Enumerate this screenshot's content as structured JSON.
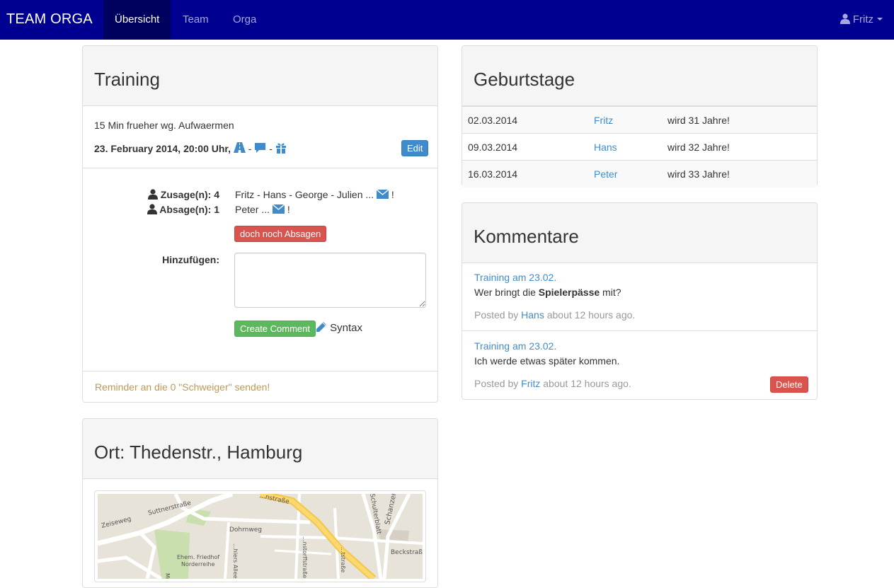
{
  "navbar": {
    "brand": "TEAM ORGA",
    "tabs": [
      {
        "label": "Übersicht",
        "active": true
      },
      {
        "label": "Team",
        "active": false
      },
      {
        "label": "Orga",
        "active": false
      }
    ],
    "user": "Fritz",
    "bg_color": "#000090"
  },
  "training": {
    "title": "Training",
    "note": "15 Min frueher wg. Aufwaermen",
    "datetime": "23. February 2014, 20:00 Uhr,",
    "sep1": "-",
    "sep2": "-",
    "edit_label": "Edit",
    "icons": [
      "road-icon",
      "comment-icon",
      "gift-icon"
    ],
    "zusage_label": "Zusage(n): 4",
    "zusage_names": "Fritz - Hans - George - Julien ...",
    "absage_label": "Absage(n): 1",
    "absage_names": "Peter ...",
    "excl": "!",
    "decline_label": "doch noch Absagen",
    "add_label": "Hinzufügen:",
    "create_label": "Create Comment",
    "syntax_label": "Syntax",
    "reminder": "Reminder an die 0 \"Schweiger\" senden!"
  },
  "ort": {
    "title": "Ort: Thedenstr., Hamburg",
    "map_labels": [
      "Zeiseweg",
      "Suttnerstraße",
      "Dohrnweg",
      "Ehem. Friedhof",
      "Norderreihe",
      "Mumsenstraße",
      "Schulterblatt",
      "Schanzen",
      "Beckstraße",
      "...nstraße",
      "...hiers Allee",
      "...nstorffstraße",
      "...tstraße"
    ]
  },
  "birthdays": {
    "title": "Geburtstage",
    "rows": [
      {
        "date": "02.03.2014",
        "name": "Fritz",
        "text": "wird 31 Jahre!"
      },
      {
        "date": "09.03.2014",
        "name": "Hans",
        "text": "wird 32 Jahre!"
      },
      {
        "date": "16.03.2014",
        "name": "Peter",
        "text": "wird 33 Jahre!"
      }
    ]
  },
  "comments": {
    "title": "Kommentare",
    "items": [
      {
        "link": "Training am 23.02.",
        "text_before": "Wer bringt die ",
        "text_bold": "Spielerpässe",
        "text_after": " mit?",
        "posted_by": "Posted by",
        "author": "Hans",
        "time": "about 12 hours ago."
      },
      {
        "link": "Training am 23.02.",
        "text_before": "Ich werde etwas später kommen.",
        "text_bold": "",
        "text_after": "",
        "posted_by": "Posted by",
        "author": "Fritz",
        "time": "about 12 hours ago.",
        "delete_label": "Delete"
      }
    ]
  }
}
